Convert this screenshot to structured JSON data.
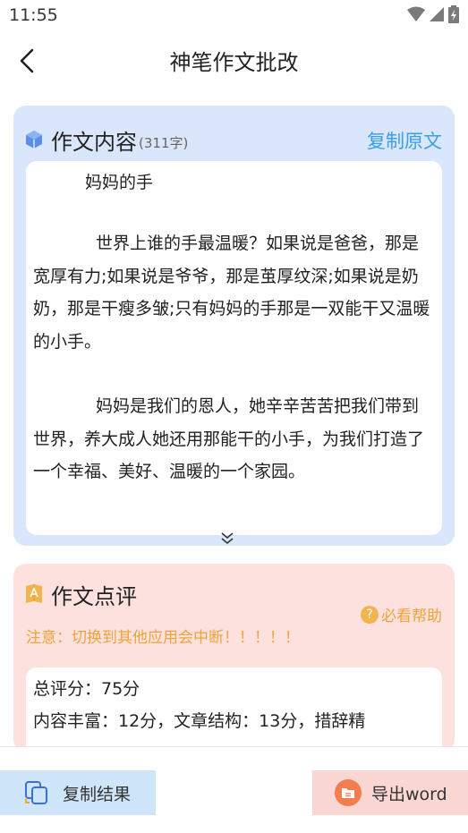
{
  "status_bar": {
    "time": "11:55"
  },
  "nav": {
    "title": "神笔作文批改"
  },
  "essay_card": {
    "title": "作文内容",
    "char_count": "(311字)",
    "copy_original_label": "复制原文",
    "essay_title": "妈妈的手",
    "paragraphs": [
      "世界上谁的手最温暖？如果说是爸爸，那是宽厚有力;如果说是爷爷，那是茧厚纹深;如果说是奶奶，那是干瘦多皱;只有妈妈的手那是一双能干又温暖的小手。",
      "妈妈是我们的恩人，她辛辛苦苦把我们带到世界，养大成人她还用那能干的小手，为我们打造了一个幸福、美好、温暖的一个家园。"
    ]
  },
  "review_card": {
    "title": "作文点评",
    "help_label": "必看帮助",
    "help_icon_glyph": "?",
    "notice": "注意：切换到其他应用会中断！！！！！",
    "score_lines": [
      "总评分：75分",
      "内容丰富：12分，文章结构：13分，措辞精"
    ]
  },
  "bottom_bar": {
    "copy_result_label": "复制结果",
    "export_label": "导出word"
  },
  "colors": {
    "essay_card_bg": "#d9e6fb",
    "review_card_bg": "#fde1df",
    "accent_blue": "#3aa0e6",
    "accent_orange": "#f0a33a",
    "copy_btn_bg": "#cfe6fa",
    "export_btn_bg": "#fbd7d3"
  },
  "icons": {
    "back": "chevron-left-icon",
    "essay": "cube-icon",
    "review": "book-icon",
    "expand": "double-chevron-down-icon",
    "copy": "copy-icon",
    "export": "document-icon"
  }
}
